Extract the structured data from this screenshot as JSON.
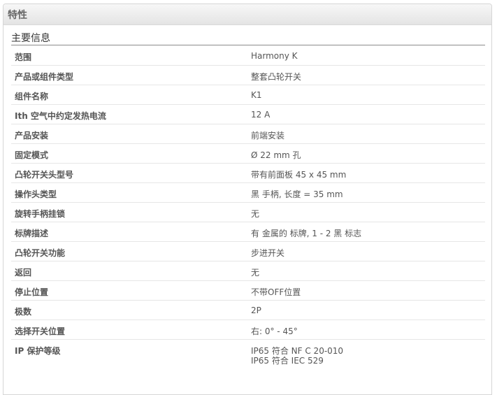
{
  "header": {
    "title": "特性"
  },
  "section": {
    "title": "主要信息"
  },
  "rows": [
    {
      "key": "范围",
      "value": "Harmony K"
    },
    {
      "key": "产品或组件类型",
      "value": "整套凸轮开关"
    },
    {
      "key": "组件名称",
      "value": "K1"
    },
    {
      "key": "Ith 空气中约定发热电流",
      "value": "12 A"
    },
    {
      "key": "产品安装",
      "value": "前端安装"
    },
    {
      "key": "固定模式",
      "value": "Ø 22 mm 孔"
    },
    {
      "key": "凸轮开关头型号",
      "value": "带有前面板 45 x 45 mm"
    },
    {
      "key": "操作头类型",
      "value": "黑 手柄, 长度 = 35 mm"
    },
    {
      "key": "旋转手柄挂锁",
      "value": "无"
    },
    {
      "key": "标牌描述",
      "value": "有 金属的 标牌, 1 - 2 黑 标志"
    },
    {
      "key": "凸轮开关功能",
      "value": "步进开关"
    },
    {
      "key": "返回",
      "value": "无"
    },
    {
      "key": "停止位置",
      "value": "不带OFF位置"
    },
    {
      "key": "极数",
      "value": "2P"
    },
    {
      "key": "选择开关位置",
      "value": "右: 0° - 45°"
    },
    {
      "key": "IP 保护等级",
      "value": "IP65 符合 NF C 20-010",
      "value2": "IP65 符合 IEC 529"
    }
  ]
}
